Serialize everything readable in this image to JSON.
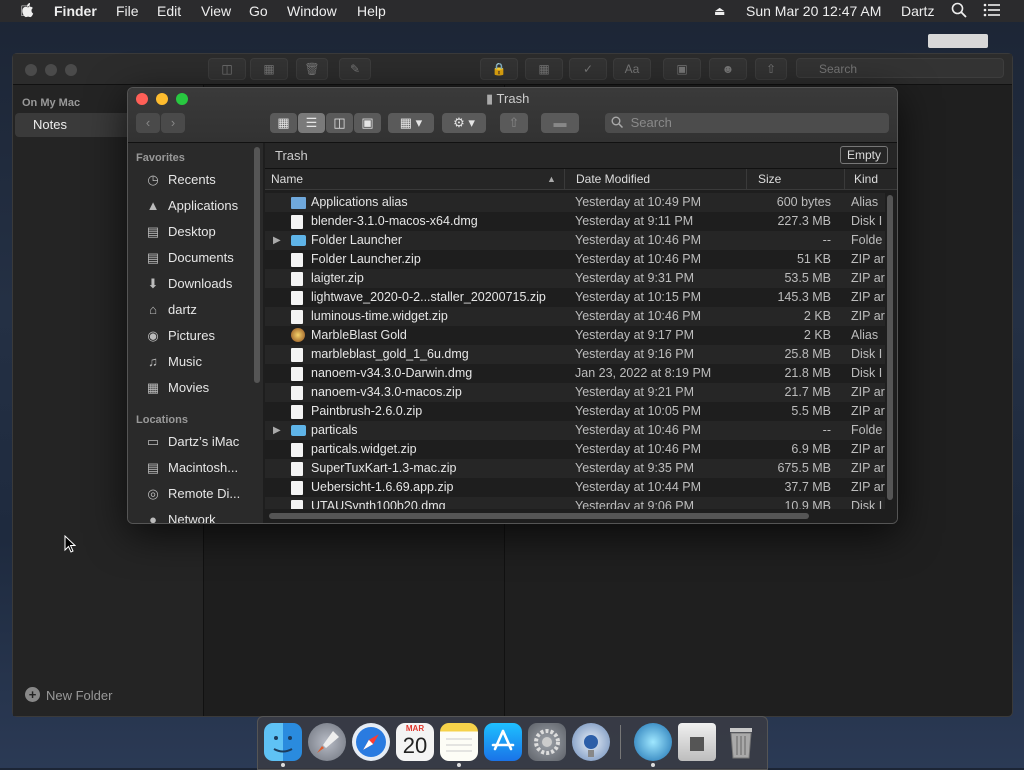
{
  "menubar": {
    "app": "Finder",
    "items": [
      "File",
      "Edit",
      "View",
      "Go",
      "Window",
      "Help"
    ],
    "clock": "Sun Mar 20  12:47 AM",
    "user": "Dartz"
  },
  "notes": {
    "section": "On My Mac",
    "folder": "Notes",
    "new_folder": "New Folder",
    "search_placeholder": "Search"
  },
  "finder": {
    "title": "Trash",
    "search_placeholder": "Search",
    "path": "Trash",
    "empty_button": "Empty",
    "sidebar": {
      "favorites_label": "Favorites",
      "favorites": [
        {
          "label": "Recents",
          "icon": "clock-icon"
        },
        {
          "label": "Applications",
          "icon": "applications-icon"
        },
        {
          "label": "Desktop",
          "icon": "desktop-icon"
        },
        {
          "label": "Documents",
          "icon": "document-icon"
        },
        {
          "label": "Downloads",
          "icon": "download-icon"
        },
        {
          "label": "dartz",
          "icon": "home-icon"
        },
        {
          "label": "Pictures",
          "icon": "camera-icon"
        },
        {
          "label": "Music",
          "icon": "music-icon"
        },
        {
          "label": "Movies",
          "icon": "film-icon"
        }
      ],
      "locations_label": "Locations",
      "locations": [
        {
          "label": "Dartz’s iMac",
          "icon": "computer-icon"
        },
        {
          "label": "Macintosh...",
          "icon": "disk-icon"
        },
        {
          "label": "Remote Di...",
          "icon": "remote-disc-icon"
        },
        {
          "label": "Network",
          "icon": "network-icon"
        }
      ]
    },
    "columns": {
      "name": "Name",
      "date": "Date Modified",
      "size": "Size",
      "kind": "Kind"
    },
    "files": [
      {
        "name": "Applications alias",
        "date": "Yesterday at 10:49 PM",
        "size": "600 bytes",
        "kind": "Alias",
        "type": "alias"
      },
      {
        "name": "blender-3.1.0-macos-x64.dmg",
        "date": "Yesterday at 9:11 PM",
        "size": "227.3 MB",
        "kind": "Disk I",
        "type": "file"
      },
      {
        "name": "Folder Launcher",
        "date": "Yesterday at 10:46 PM",
        "size": "--",
        "kind": "Folde",
        "type": "folder"
      },
      {
        "name": "Folder Launcher.zip",
        "date": "Yesterday at 10:46 PM",
        "size": "51 KB",
        "kind": "ZIP ar",
        "type": "file"
      },
      {
        "name": "laigter.zip",
        "date": "Yesterday at 9:31 PM",
        "size": "53.5 MB",
        "kind": "ZIP ar",
        "type": "file"
      },
      {
        "name": "lightwave_2020-0-2...staller_20200715.zip",
        "date": "Yesterday at 10:15 PM",
        "size": "145.3 MB",
        "kind": "ZIP ar",
        "type": "file"
      },
      {
        "name": "luminous-time.widget.zip",
        "date": "Yesterday at 10:46 PM",
        "size": "2 KB",
        "kind": "ZIP ar",
        "type": "file"
      },
      {
        "name": "MarbleBlast Gold",
        "date": "Yesterday at 9:17 PM",
        "size": "2 KB",
        "kind": "Alias",
        "type": "gold"
      },
      {
        "name": "marbleblast_gold_1_6u.dmg",
        "date": "Yesterday at 9:16 PM",
        "size": "25.8 MB",
        "kind": "Disk I",
        "type": "file"
      },
      {
        "name": "nanoem-v34.3.0-Darwin.dmg",
        "date": "Jan 23, 2022 at 8:19 PM",
        "size": "21.8 MB",
        "kind": "Disk I",
        "type": "file"
      },
      {
        "name": "nanoem-v34.3.0-macos.zip",
        "date": "Yesterday at 9:21 PM",
        "size": "21.7 MB",
        "kind": "ZIP ar",
        "type": "file"
      },
      {
        "name": "Paintbrush-2.6.0.zip",
        "date": "Yesterday at 10:05 PM",
        "size": "5.5 MB",
        "kind": "ZIP ar",
        "type": "file"
      },
      {
        "name": "particals",
        "date": "Yesterday at 10:46 PM",
        "size": "--",
        "kind": "Folde",
        "type": "folder"
      },
      {
        "name": "particals.widget.zip",
        "date": "Yesterday at 10:46 PM",
        "size": "6.9 MB",
        "kind": "ZIP ar",
        "type": "file"
      },
      {
        "name": "SuperTuxKart-1.3-mac.zip",
        "date": "Yesterday at 9:35 PM",
        "size": "675.5 MB",
        "kind": "ZIP ar",
        "type": "file"
      },
      {
        "name": "Uebersicht-1.6.69.app.zip",
        "date": "Yesterday at 10:44 PM",
        "size": "37.7 MB",
        "kind": "ZIP ar",
        "type": "file"
      },
      {
        "name": "UTAUSynth100b20.dmg",
        "date": "Yesterday at 9:06 PM",
        "size": "10.9 MB",
        "kind": "Disk I",
        "type": "file"
      }
    ]
  },
  "dock": {
    "calendar_month": "MAR",
    "calendar_day": "20",
    "apps": [
      "finder-icon",
      "launchpad-icon",
      "safari-icon",
      "calendar-icon",
      "notes-icon",
      "app-store-icon",
      "system-preferences-icon",
      "migration-icon",
      "marble-icon",
      "preview-icon",
      "trash-icon"
    ]
  }
}
